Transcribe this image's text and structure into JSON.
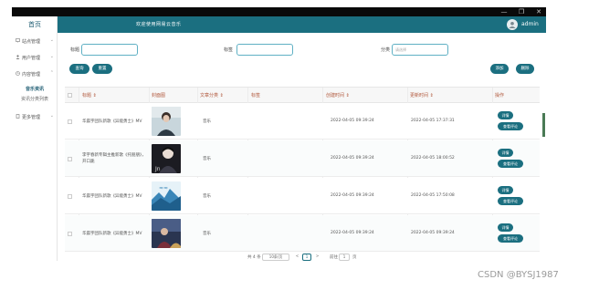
{
  "window": {
    "minimize": "—",
    "maximize": "❐",
    "close": "✕"
  },
  "sidebar": {
    "brand": "首页",
    "items": [
      {
        "label": "站点管理",
        "icon": "monitor-icon"
      },
      {
        "label": "用户管理",
        "icon": "user-icon"
      },
      {
        "label": "内容管理",
        "icon": "clock-icon"
      }
    ],
    "sub_active": "音乐资讯",
    "sub_inactive": "资讯分类列表",
    "more": {
      "label": "更多管理",
      "icon": "doc-icon"
    }
  },
  "header": {
    "title": "欢迎使用网易云音乐",
    "user": "admin"
  },
  "search": {
    "title_label": "标题",
    "title_value": "",
    "tags_label": "标签",
    "tags_value": "",
    "category_label": "分类",
    "category_placeholder": "请选择"
  },
  "buttons": {
    "query": "查询",
    "reset": "重置",
    "add": "添加",
    "delete": "删除"
  },
  "table": {
    "headers": [
      "标题 ⇕",
      "封面图",
      "文章分类 ⇕",
      "标签",
      "创建时间 ⇕",
      "更新时间 ⇕",
      "操作"
    ],
    "rows": [
      {
        "title": "华晨宇团队新歌《异能勇士》MV",
        "category": "音乐",
        "tags": "",
        "created": "2022-04-05 09:39:24",
        "updated": "2022-04-05 17:37:31",
        "op1": "详情",
        "op2": "查看评论"
      },
      {
        "title": "李宇春新专辑主推新歌《托朋朋》，开口跪",
        "category": "音乐",
        "tags": "",
        "created": "2022-04-05 09:39:24",
        "updated": "2022-04-05 18:00:52",
        "op1": "详情",
        "op2": "查看评论"
      },
      {
        "title": "华晨宇团队新歌《异能勇士》MV",
        "category": "音乐",
        "tags": "",
        "created": "2022-04-05 09:39:24",
        "updated": "2022-04-05 17:50:08",
        "op1": "详情",
        "op2": "查看评论"
      },
      {
        "title": "华晨宇团队新歌《异能勇士》MV",
        "category": "音乐",
        "tags": "",
        "created": "2022-04-05 09:39:24",
        "updated": "2022-04-05 09:39:24",
        "op1": "详情",
        "op2": "查看评论"
      }
    ]
  },
  "pager": {
    "total": "共 4 条",
    "page_size": "10条/页",
    "prev": "<",
    "page": "1",
    "next": ">",
    "goto": "前往",
    "goto_value": "1",
    "page_unit": "页"
  },
  "watermark": "CSDN @BYSJ1987",
  "colors": {
    "accent": "#1b6f80",
    "header_text": "#b0563a"
  }
}
